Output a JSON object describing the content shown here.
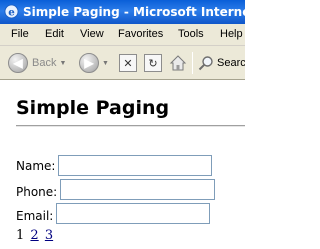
{
  "window": {
    "title": "Simple Paging - Microsoft Internet Explorer"
  },
  "menu": [
    "File",
    "Edit",
    "View",
    "Favorites",
    "Tools",
    "Help"
  ],
  "toolbar": {
    "back_label": "Back",
    "search_label": "Search"
  },
  "page": {
    "heading": "Simple Paging"
  },
  "form": {
    "name_label": "Name:",
    "phone_label": "Phone:",
    "email_label": "Email:",
    "name_value": "",
    "phone_value": "",
    "email_value": ""
  },
  "pager": {
    "current": "1",
    "links": [
      "2",
      "3"
    ]
  }
}
